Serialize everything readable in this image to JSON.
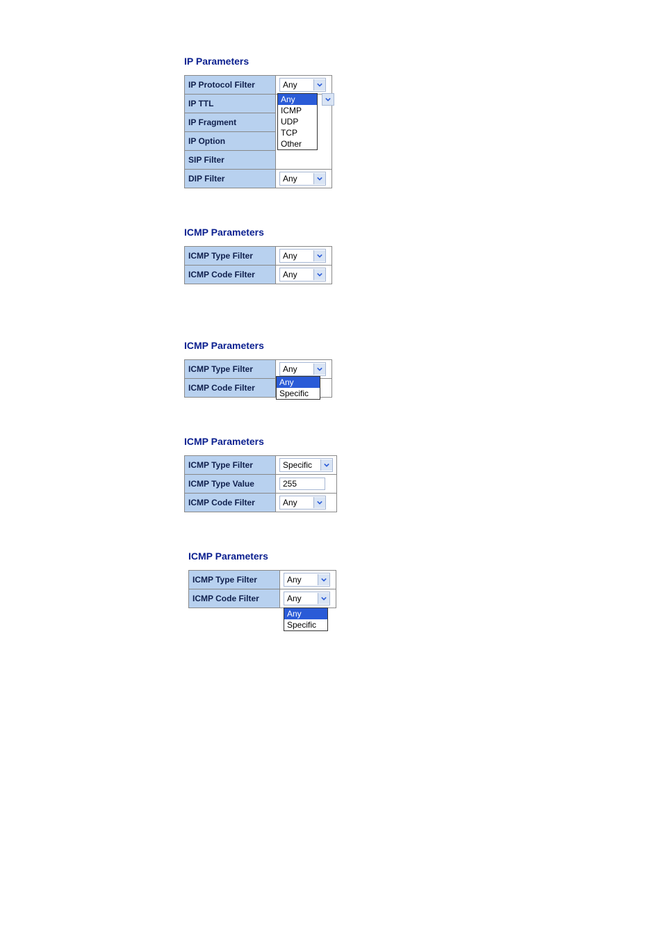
{
  "section1": {
    "title": "IP Parameters",
    "rows": {
      "protocol_label": "IP Protocol Filter",
      "protocol_value": "Any",
      "ttl_label": "IP TTL",
      "fragment_label": "IP Fragment",
      "option_label": "IP Option",
      "sip_label": "SIP Filter",
      "dip_label": "DIP Filter",
      "dip_value": "Any"
    },
    "protocol_dropdown": {
      "opt0": "Any",
      "opt1": "ICMP",
      "opt2": "UDP",
      "opt3": "TCP",
      "opt4": "Other"
    }
  },
  "section2": {
    "title": "ICMP Parameters",
    "rows": {
      "type_label": "ICMP Type Filter",
      "type_value": "Any",
      "code_label": "ICMP Code Filter",
      "code_value": "Any"
    }
  },
  "section3": {
    "title": "ICMP Parameters",
    "rows": {
      "type_label": "ICMP Type Filter",
      "type_value": "Any",
      "code_label": "ICMP Code Filter"
    },
    "type_dropdown": {
      "opt0": "Any",
      "opt1": "Specific"
    }
  },
  "section4": {
    "title": "ICMP Parameters",
    "rows": {
      "type_label": "ICMP Type Filter",
      "type_value": "Specific",
      "value_label": "ICMP Type Value",
      "value_value": "255",
      "code_label": "ICMP Code Filter",
      "code_value": "Any"
    }
  },
  "section5": {
    "title": "ICMP Parameters",
    "rows": {
      "type_label": "ICMP Type Filter",
      "type_value": "Any",
      "code_label": "ICMP Code Filter",
      "code_value": "Any"
    },
    "code_dropdown": {
      "opt0": "Any",
      "opt1": "Specific"
    }
  }
}
